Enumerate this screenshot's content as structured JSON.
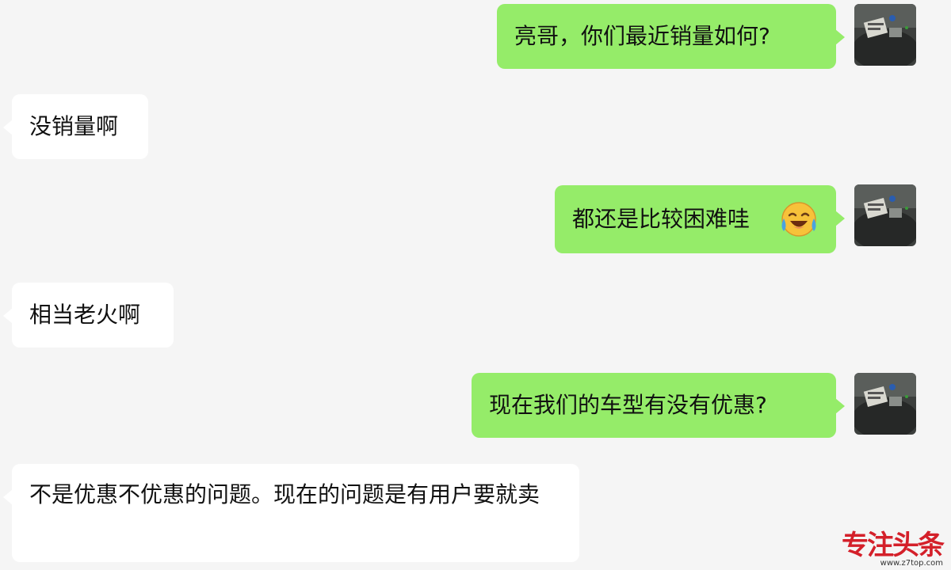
{
  "chat": {
    "messages": [
      {
        "side": "out",
        "text": "亮哥，你们最近销量如何?",
        "avatar_icon": "user-avatar-photo"
      },
      {
        "side": "in",
        "text": "没销量啊"
      },
      {
        "side": "out",
        "text": "都还是比较困难哇",
        "emoji_icon": "laughing-crying-emoji-icon",
        "avatar_icon": "user-avatar-photo"
      },
      {
        "side": "in",
        "text": "相当老火啊"
      },
      {
        "side": "out",
        "text": "现在我们的车型有没有优惠?",
        "avatar_icon": "user-avatar-photo"
      },
      {
        "side": "in",
        "text": "不是优惠不优惠的问题。现在的问题是有用户要就卖"
      }
    ]
  },
  "watermark": {
    "brand": "专注头条",
    "url": "www.z7top.com"
  },
  "colors": {
    "background": "#f5f5f5",
    "outgoing_bubble": "#95ec69",
    "incoming_bubble": "#ffffff",
    "watermark_red": "#d4202a"
  }
}
